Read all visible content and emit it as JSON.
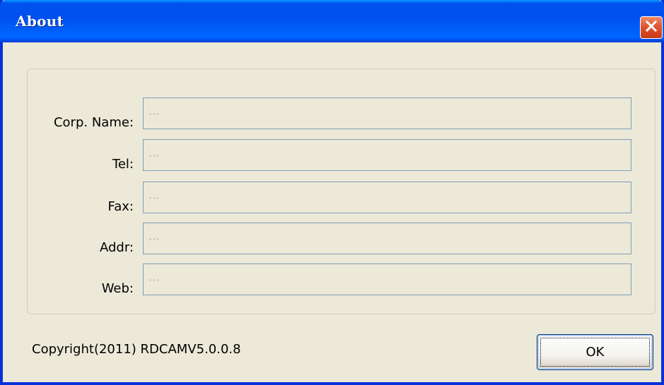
{
  "window": {
    "title": "About",
    "close_icon": "close-x-icon",
    "colors": {
      "titlebar": "#0053ee",
      "body": "#ece9d8",
      "close": "#e2552f"
    }
  },
  "fields": [
    {
      "label": "Corp. Name:",
      "value": "···"
    },
    {
      "label": "Tel:",
      "value": "···"
    },
    {
      "label": "Fax:",
      "value": "···"
    },
    {
      "label": "Addr:",
      "value": "···"
    },
    {
      "label": "Web:",
      "value": "···"
    }
  ],
  "footer": {
    "copyright": "Copyright(2011) RDCAMV5.0.0.8",
    "ok_label": "OK"
  }
}
